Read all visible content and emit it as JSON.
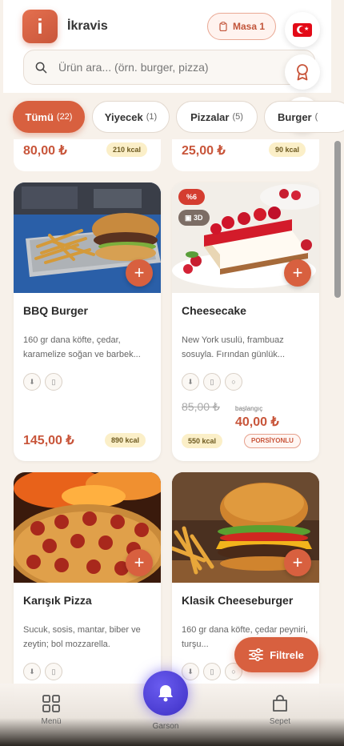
{
  "header": {
    "logo_letter": "i",
    "app_name": "İkravis",
    "table_label": "Masa 1",
    "search_placeholder": "Ürün ara... (örn. burger, pizza)"
  },
  "side_buttons": {
    "language_icon": "turkey-flag-icon",
    "loyalty_icon": "award-icon",
    "help_icon": "help-circle-icon"
  },
  "categories": [
    {
      "label": "Tümü",
      "count": "(22)",
      "active": true
    },
    {
      "label": "Yiyecek",
      "count": "(1)",
      "active": false
    },
    {
      "label": "Pizzalar",
      "count": "(5)",
      "active": false
    },
    {
      "label": "Burger",
      "count": "(",
      "active": false
    }
  ],
  "partial_cards": [
    {
      "price": "80,00 ₺",
      "kcal": "210 kcal"
    },
    {
      "price": "25,00 ₺",
      "kcal": "90 kcal"
    }
  ],
  "products": [
    {
      "name": "BBQ Burger",
      "description": "160 gr dana köfte, çedar, karamelize soğan ve barbek...",
      "price": "145,00 ₺",
      "kcal": "890 kcal"
    },
    {
      "name": "Cheesecake",
      "description": "New York usulü, frambuaz sosuyla. Fırından günlük...",
      "discount_badge": "%6",
      "badge_3d": "3D",
      "old_price": "85,00 ₺",
      "from_label": "başlangıç",
      "price": "40,00 ₺",
      "kcal": "550 kcal",
      "portion_label": "PORSİYONLU"
    },
    {
      "name": "Karışık Pizza",
      "description": "Sucuk, sosis, mantar, biber ve zeytin; bol mozzarella."
    },
    {
      "name": "Klasik Cheeseburger",
      "description": "160 gr dana köfte, çedar peyniri, turşu..."
    }
  ],
  "filter_button": "Filtrele",
  "nav": {
    "menu": "Menü",
    "waiter": "Garson",
    "cart": "Sepet"
  },
  "colors": {
    "accent": "#d8603f",
    "price": "#c8553a",
    "waiter": "#4a3cd8"
  }
}
